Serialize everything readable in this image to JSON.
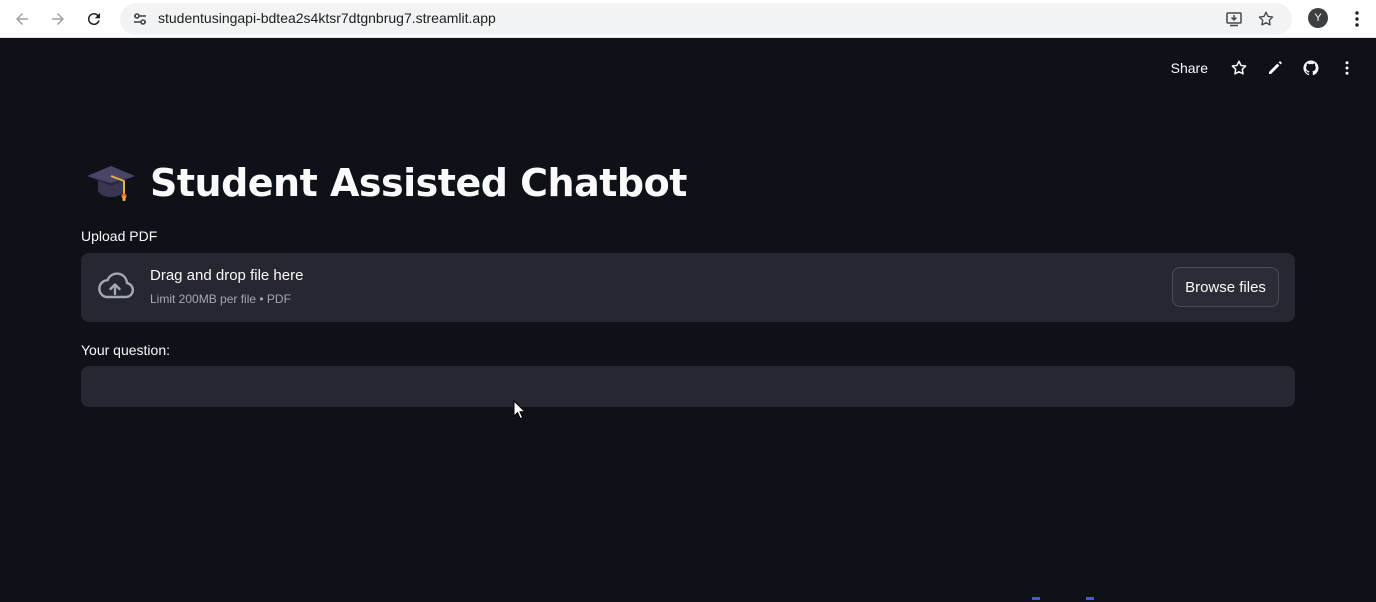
{
  "browser": {
    "url": "studentusingapi-bdtea2s4ktsr7dtgnbrug7.streamlit.app",
    "profile_initial": "Y",
    "icons": [
      "back-icon",
      "forward-icon",
      "reload-icon",
      "site-info-icon",
      "install-app-icon",
      "bookmark-star-icon",
      "more-vert-icon"
    ]
  },
  "toolbar": {
    "share_label": "Share",
    "icons": [
      "star-icon",
      "edit-icon",
      "github-icon",
      "more-vert-icon"
    ]
  },
  "main": {
    "title": "Student Assisted Chatbot",
    "title_icon": "graduation-cap-icon",
    "upload": {
      "label": "Upload PDF",
      "drag_text": "Drag and drop file here",
      "limit_text": "Limit 200MB per file • PDF",
      "browse_label": "Browse files"
    },
    "question": {
      "label": "Your question:",
      "value": ""
    }
  },
  "colors": {
    "background": "#0e1117",
    "widget_bg": "#262730",
    "text": "#fafafa",
    "muted_text": "#a3a8b8"
  }
}
